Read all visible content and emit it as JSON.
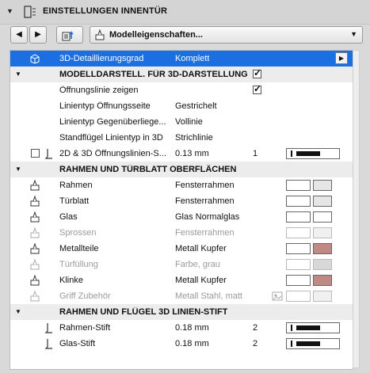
{
  "panel_title": "EINSTELLUNGEN INNENTÜR",
  "toolbar": {
    "prev": "◀",
    "next": "▶",
    "model_button": "Modelleigenschaften..."
  },
  "rows": {
    "detail": {
      "label": "3D-Detaillierungsgrad",
      "value": "Komplett"
    },
    "sec_model": {
      "label": "MODELLDARSTELL. FÜR 3D-DARSTELLUNG Ü..."
    },
    "oeff": {
      "label": "Öffnungslinie zeigen"
    },
    "lt_oeff": {
      "label": "Linientyp Öffnungsseite",
      "value": "Gestrichelt"
    },
    "lt_gegen": {
      "label": "Linientyp Gegenüberliege...",
      "value": "Vollinie"
    },
    "stand": {
      "label": "Standflügel Linientyp in 3D",
      "value": "Strichlinie"
    },
    "pen2d": {
      "label": "2D & 3D Öffnungslinien-S...",
      "value": "0.13 mm",
      "num": "1"
    },
    "sec_rahmen": {
      "label": "RAHMEN UND TÜRBLATT OBERFLÄCHEN"
    },
    "rahmen": {
      "label": "Rahmen",
      "value": "Fensterrahmen"
    },
    "tuerblatt": {
      "label": "Türblatt",
      "value": "Fensterrahmen"
    },
    "glas": {
      "label": "Glas",
      "value": "Glas Normalglas"
    },
    "sprossen": {
      "label": "Sprossen",
      "value": "Fensterrahmen"
    },
    "metall": {
      "label": "Metallteile",
      "value": "Metall Kupfer"
    },
    "fuellung": {
      "label": "Türfüllung",
      "value": "Farbe, grau"
    },
    "klinke": {
      "label": "Klinke",
      "value": "Metall Kupfer"
    },
    "griff": {
      "label": "Griff Zubehör",
      "value": "Metall Stahl, matt"
    },
    "sec_stift": {
      "label": "RAHMEN UND FLÜGEL 3D LINIEN-STIFT"
    },
    "rstift": {
      "label": "Rahmen-Stift",
      "value": "0.18 mm",
      "num": "2"
    },
    "gstift": {
      "label": "Glas-Stift",
      "value": "0.18 mm",
      "num": "2"
    }
  },
  "colors": {
    "selection": "#1c6fe0",
    "copper": "#c08a84",
    "grey": "#d8d8d8"
  }
}
